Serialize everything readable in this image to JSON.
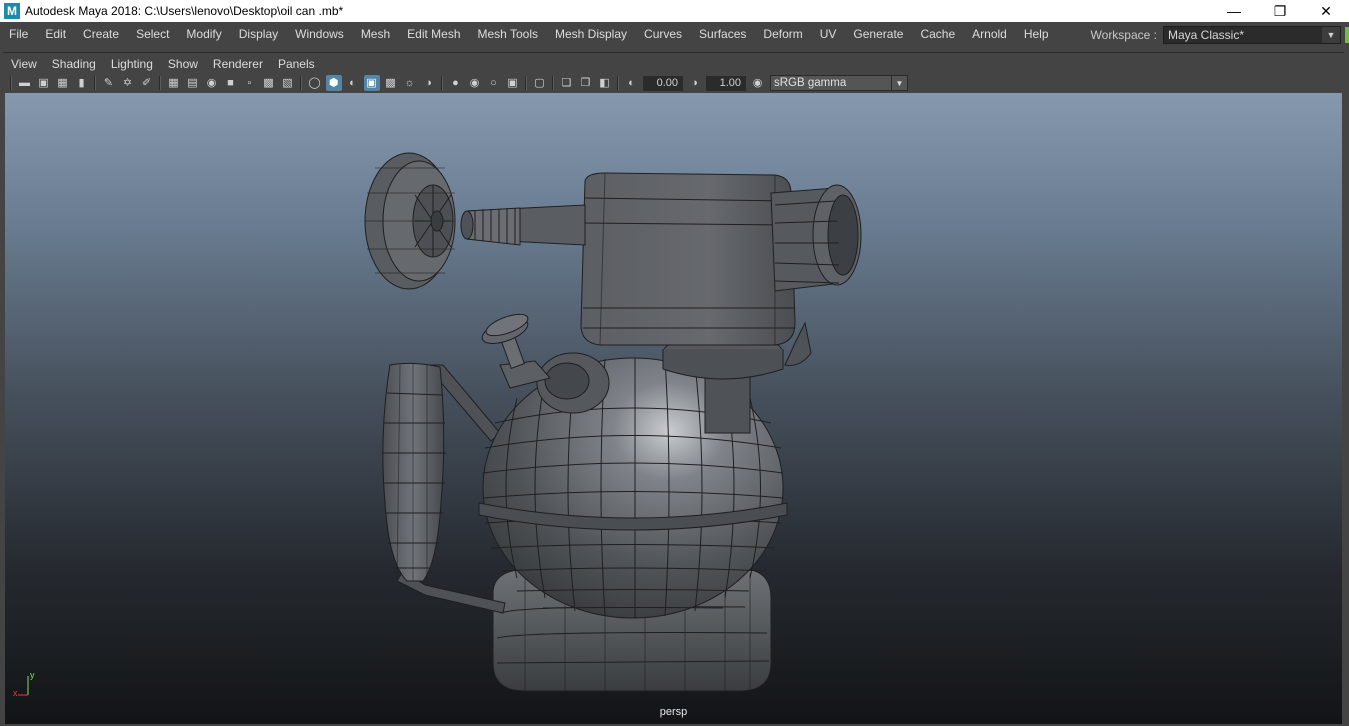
{
  "window": {
    "title": "Autodesk Maya 2018: C:\\Users\\lenovo\\Desktop\\oil can .mb*",
    "logo_letter": "M",
    "controls": {
      "minimize": "—",
      "restore": "❐",
      "close": "✕"
    }
  },
  "menubar": {
    "items": [
      "File",
      "Edit",
      "Create",
      "Select",
      "Modify",
      "Display",
      "Windows",
      "Mesh",
      "Edit Mesh",
      "Mesh Tools",
      "Mesh Display",
      "Curves",
      "Surfaces",
      "Deform",
      "UV",
      "Generate",
      "Cache",
      "Arnold",
      "Help"
    ],
    "workspace_label": "Workspace :",
    "workspace_value": "Maya Classic*"
  },
  "panel": {
    "menu": [
      "View",
      "Shading",
      "Lighting",
      "Show",
      "Renderer",
      "Panels"
    ],
    "toolbar": {
      "exposure": "0.00",
      "gamma": "1.00",
      "color_space": "sRGB gamma"
    }
  },
  "viewport": {
    "camera_label": "persp",
    "axis": {
      "x": "x",
      "y": "y"
    },
    "colors": {
      "gradient_top": "#8698ae",
      "gradient_bottom": "#121416",
      "mesh_fill": "#505357",
      "wire": "#1e1f21"
    }
  }
}
